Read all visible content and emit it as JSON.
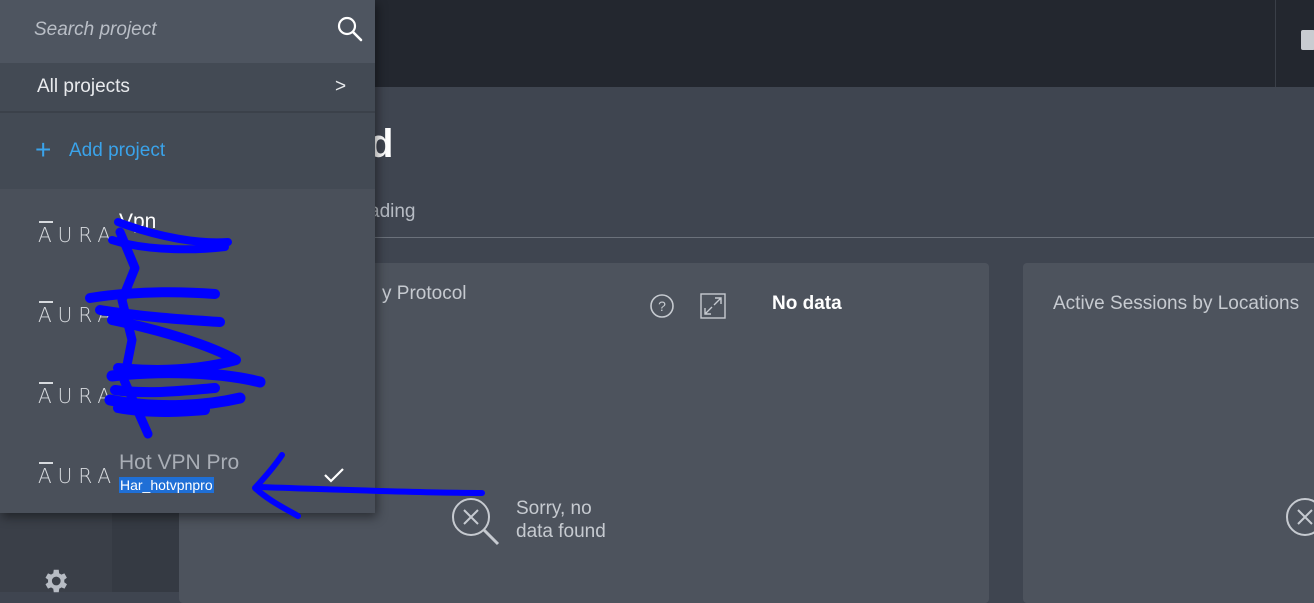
{
  "dashboard": {
    "title_fragment": "d",
    "tab_fragment": "ading",
    "card1": {
      "title_fragment": "y Protocol",
      "no_data": "No data",
      "empty_line1": "Sorry, no",
      "empty_line2": "data found"
    },
    "card2": {
      "title": "Active Sessions by Locations"
    }
  },
  "dropdown": {
    "search_placeholder": "Search project",
    "all_projects_label": "All projects",
    "all_projects_arrow": ">",
    "add_project_plus": "+",
    "add_project_label": "Add project",
    "projects": [
      {
        "logo": "AURA",
        "name": "Vpn",
        "sub": ""
      },
      {
        "logo": "AURA",
        "name": "",
        "sub": ""
      },
      {
        "logo": "AURA",
        "name": "",
        "sub": ""
      },
      {
        "logo": "AURA",
        "name": "Hot VPN Pro",
        "sub": "Har_hotvpnpro",
        "selected": true
      }
    ]
  },
  "colors": {
    "accent": "#3aa3ea",
    "scribble": "#0000ff",
    "topbar": "#23272f"
  }
}
